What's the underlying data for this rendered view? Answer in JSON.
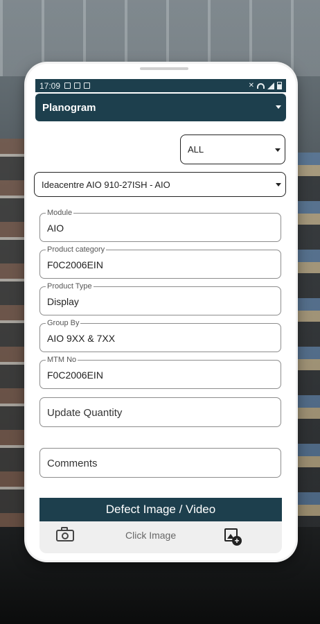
{
  "status_bar": {
    "time": "17:09"
  },
  "header": {
    "title": "Planogram"
  },
  "filter": {
    "selected": "ALL"
  },
  "product": {
    "selected": "Ideacentre AIO 910-27ISH - AIO"
  },
  "fields": [
    {
      "label": "Module",
      "value": "AIO"
    },
    {
      "label": "Product category",
      "value": "F0C2006EIN"
    },
    {
      "label": "Product Type",
      "value": "Display"
    },
    {
      "label": "Group By",
      "value": "AIO 9XX & 7XX"
    },
    {
      "label": "MTM No",
      "value": "F0C2006EIN"
    }
  ],
  "update_quantity": {
    "placeholder": "Update Quantity"
  },
  "comments": {
    "placeholder": "Comments"
  },
  "defect": {
    "title": "Defect Image / Video",
    "click_label": "Click Image"
  },
  "colors": {
    "accent": "#1d3f4d",
    "image_row_bg": "#efefef"
  },
  "icons": [
    "camera-icon",
    "add-photo-icon",
    "chevron-down-icon",
    "wifi-icon",
    "signal-icon",
    "battery-icon"
  ]
}
